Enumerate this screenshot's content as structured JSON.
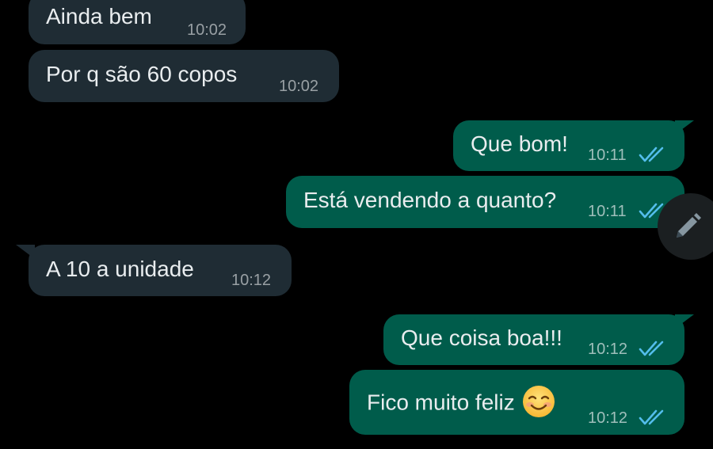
{
  "messages": [
    {
      "direction": "incoming",
      "text": "Ainda bem",
      "time": "10:02"
    },
    {
      "direction": "incoming",
      "text": "Por q são 60 copos",
      "time": "10:02"
    },
    {
      "direction": "outgoing",
      "text": "Que bom!",
      "time": "10:11",
      "status": "read"
    },
    {
      "direction": "outgoing",
      "text": "Está vendendo a quanto?",
      "time": "10:11",
      "status": "read"
    },
    {
      "direction": "incoming",
      "text": "A 10 a unidade",
      "time": "10:12"
    },
    {
      "direction": "outgoing",
      "text": "Que coisa boa!!!",
      "time": "10:12",
      "status": "read"
    },
    {
      "direction": "outgoing",
      "text": "Fico muito feliz",
      "time": "10:12",
      "status": "read",
      "emoji": "smiling-face-with-smiling-eyes"
    }
  ],
  "icons": {
    "read_receipt": "double-check-icon",
    "edit_button": "pencil-icon"
  },
  "colors": {
    "background": "#000000",
    "incoming_bubble": "#1f2c34",
    "outgoing_bubble": "#005c4b",
    "read_ticks": "#53bdeb",
    "text": "#e9edef"
  }
}
